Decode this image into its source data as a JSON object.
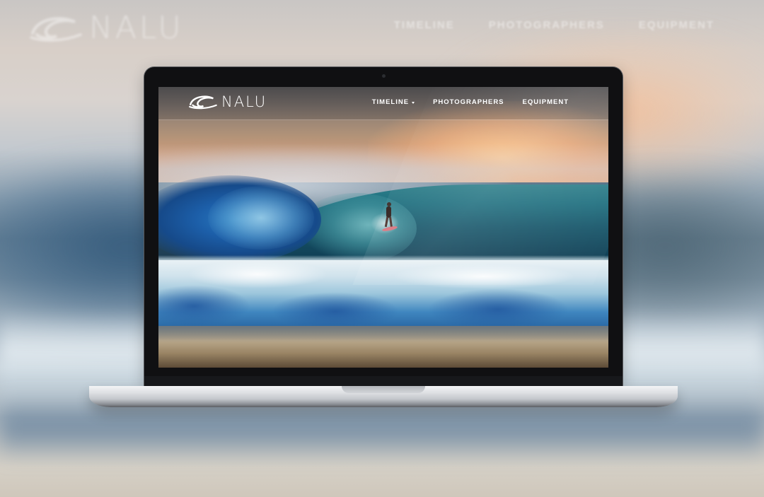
{
  "background": {
    "logo_text": "NALU",
    "menu": [
      "TIMELINE",
      "PHOTOGRAPHERS",
      "EQUIPMENT"
    ]
  },
  "site": {
    "logo_text": "NALU",
    "logo_icon": "wave-icon",
    "nav": [
      {
        "label": "TIMELINE",
        "has_dropdown": true
      },
      {
        "label": "PHOTOGRAPHERS",
        "has_dropdown": false
      },
      {
        "label": "EQUIPMENT",
        "has_dropdown": false
      }
    ]
  },
  "colors": {
    "header_text": "#ffffff",
    "sunset": "#ecaa7e",
    "ocean": "#1f5a98"
  }
}
